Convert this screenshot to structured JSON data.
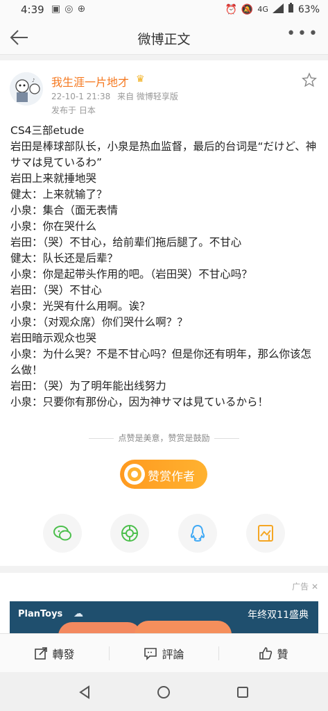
{
  "status_bar": {
    "time": "4:39",
    "notification_icons": [
      "image-icon",
      "weibo-icon",
      "download-icon"
    ],
    "network": "4G",
    "battery": "63%"
  },
  "nav": {
    "title": "微博正文"
  },
  "post": {
    "username": "我生涯一片地才",
    "badge_icon": "crown-icon",
    "date": "22-10-1 21:38",
    "source": "来自 微博轻享版",
    "location": "发布于 日本",
    "lines": [
      "CS4三部etude",
      "岩田是棒球部队长，小泉是热血监督，最后的台词是“だけど、神サマは見ているわ”",
      "岩田上来就捶地哭",
      "健太：上来就输了？",
      "小泉：集合（面无表情",
      "小泉：你在哭什么",
      "岩田：（哭）不甘心，给前辈们拖后腿了。不甘心",
      "健太：队长还是后辈？",
      "小泉：你是起带头作用的吧。（岩田哭）不甘心吗？",
      "岩田：（哭）不甘心",
      "小泉：光哭有什么用啊。诶？",
      "小泉：（对观众席）你们哭什么啊？？",
      "岩田暗示观众也哭",
      "小泉：为什么哭？不是不甘心吗？但是你还有明年，那么你该怎么做！",
      "岩田：（哭）为了明年能出线努力",
      "小泉：只要你有那份心，因为神サマは見ているから！"
    ]
  },
  "reward": {
    "hint": "点赞是美意，赞赏是鼓励",
    "button": "赞赏作者"
  },
  "share": [
    "wechat-icon",
    "moments-icon",
    "qq-icon",
    "save-image-icon"
  ],
  "ad": {
    "tag": "广告",
    "brand": "PlanToys",
    "slogan": "年终双11盛典"
  },
  "bottom_bar": {
    "repost": "轉發",
    "comment": "評論",
    "like": "贊"
  },
  "colors": {
    "username": "#f5781f",
    "reward_button": "#ff9f24",
    "ad_background": "#1f4f6e"
  }
}
